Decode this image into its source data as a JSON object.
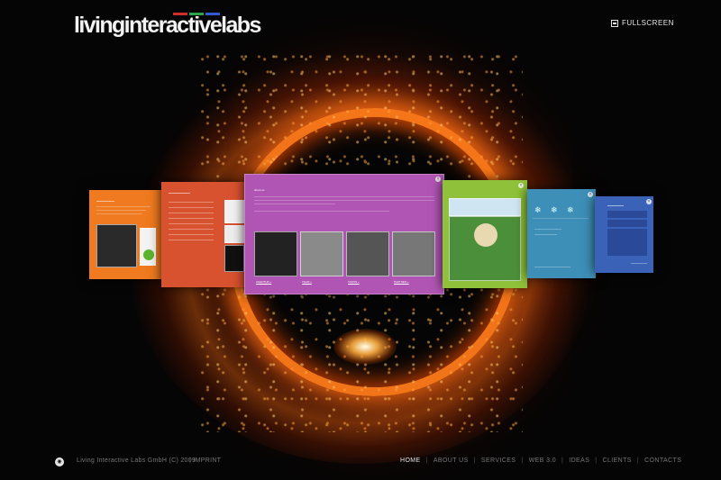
{
  "logo": {
    "text": "livinginteractivelabs",
    "bar_colors": [
      "#d22d2d",
      "#2ca34a",
      "#2f5bd0"
    ]
  },
  "header": {
    "fullscreen_label": "FULLSCREEN"
  },
  "panels": {
    "purple": {
      "title": "about us",
      "links": [
        "AGENTUR »",
        "TEAM »",
        "VISION »",
        "PARTNER »"
      ]
    }
  },
  "footer": {
    "copyright": "Living Interactive Labs GmbH (C) 2009",
    "separator": "|",
    "imprint": "IMPRINT",
    "nav": [
      {
        "label": "HOME",
        "active": true
      },
      {
        "label": "ABOUT US",
        "active": false
      },
      {
        "label": "SERVICES",
        "active": false
      },
      {
        "label": "WEB 3.0",
        "active": false
      },
      {
        "label": "IDEAS",
        "active": false
      },
      {
        "label": "CLIENTS",
        "active": false
      },
      {
        "label": "CONTACTS",
        "active": false
      }
    ]
  },
  "colors": {
    "accent_ring": "#ff7a1a",
    "panel_orange": "#ef7a1f",
    "panel_red": "#d9522f",
    "panel_purple": "#b155b4",
    "panel_green": "#8fc23a",
    "panel_teal": "#3d8fb8",
    "panel_blue": "#3a63b8"
  }
}
